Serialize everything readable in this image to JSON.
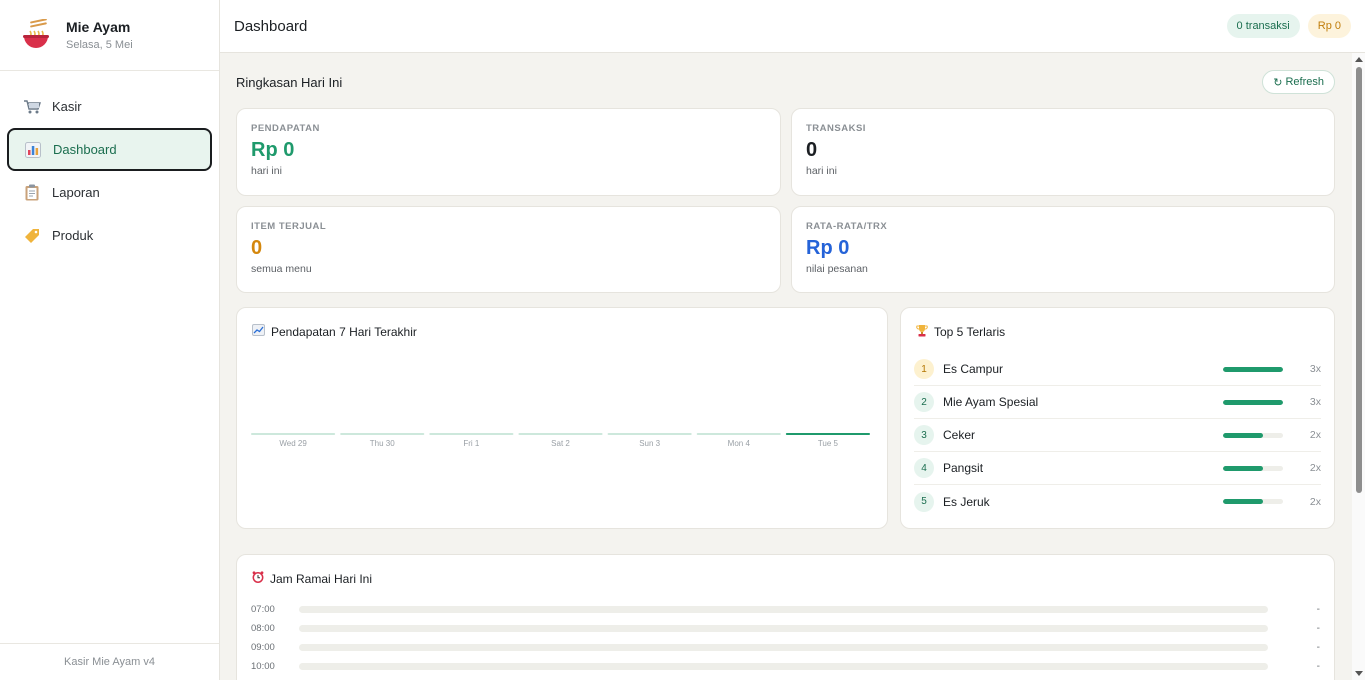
{
  "brand": {
    "name": "Mie Ayam",
    "date": "Selasa, 5 Mei"
  },
  "nav": [
    {
      "label": "Kasir",
      "icon": "shopping-cart-icon"
    },
    {
      "label": "Dashboard",
      "icon": "bar-chart-icon"
    },
    {
      "label": "Laporan",
      "icon": "clipboard-icon"
    },
    {
      "label": "Produk",
      "icon": "tag-icon"
    }
  ],
  "footer": "Kasir Mie Ayam v4",
  "topbar": {
    "title": "Dashboard",
    "transactions_pill": "0 transaksi",
    "revenue_pill": "Rp 0"
  },
  "summary": {
    "title": "Ringkasan Hari Ini",
    "refresh": "Refresh"
  },
  "stats": {
    "revenue": {
      "label": "PENDAPATAN",
      "value": "Rp 0",
      "sub": "hari ini",
      "color": "#1f9a6c"
    },
    "transactions": {
      "label": "TRANSAKSI",
      "value": "0",
      "sub": "hari ini",
      "color": "#1b1f23"
    },
    "items": {
      "label": "ITEM TERJUAL",
      "value": "0",
      "sub": "semua menu",
      "color": "#d4870d"
    },
    "average": {
      "label": "RATA-RATA/TRX",
      "value": "Rp 0",
      "sub": "nilai pesanan",
      "color": "#2563d8"
    }
  },
  "revenue_chart": {
    "title": "Pendapatan 7 Hari Terakhir"
  },
  "chart_data": {
    "type": "bar",
    "categories": [
      "Wed 29",
      "Thu 30",
      "Fri 1",
      "Sat 2",
      "Sun 3",
      "Mon 4",
      "Tue 5"
    ],
    "values": [
      0,
      0,
      0,
      0,
      0,
      0,
      0
    ],
    "highlight_index": 6,
    "colors": {
      "bar": "#cde8dc",
      "highlight": "#1f9a6c"
    }
  },
  "top5": {
    "title": "Top 5 Terlaris",
    "items": [
      {
        "rank": "1",
        "name": "Es Campur",
        "count": "3x",
        "ratio": 1.0
      },
      {
        "rank": "2",
        "name": "Mie Ayam Spesial",
        "count": "3x",
        "ratio": 1.0
      },
      {
        "rank": "3",
        "name": "Ceker",
        "count": "2x",
        "ratio": 0.667
      },
      {
        "rank": "4",
        "name": "Pangsit",
        "count": "2x",
        "ratio": 0.667
      },
      {
        "rank": "5",
        "name": "Es Jeruk",
        "count": "2x",
        "ratio": 0.667
      }
    ]
  },
  "busy_hours": {
    "title": "Jam Ramai Hari Ini",
    "rows": [
      {
        "hour": "07:00",
        "value": "-"
      },
      {
        "hour": "08:00",
        "value": "-"
      },
      {
        "hour": "09:00",
        "value": "-"
      },
      {
        "hour": "10:00",
        "value": "-"
      }
    ]
  }
}
